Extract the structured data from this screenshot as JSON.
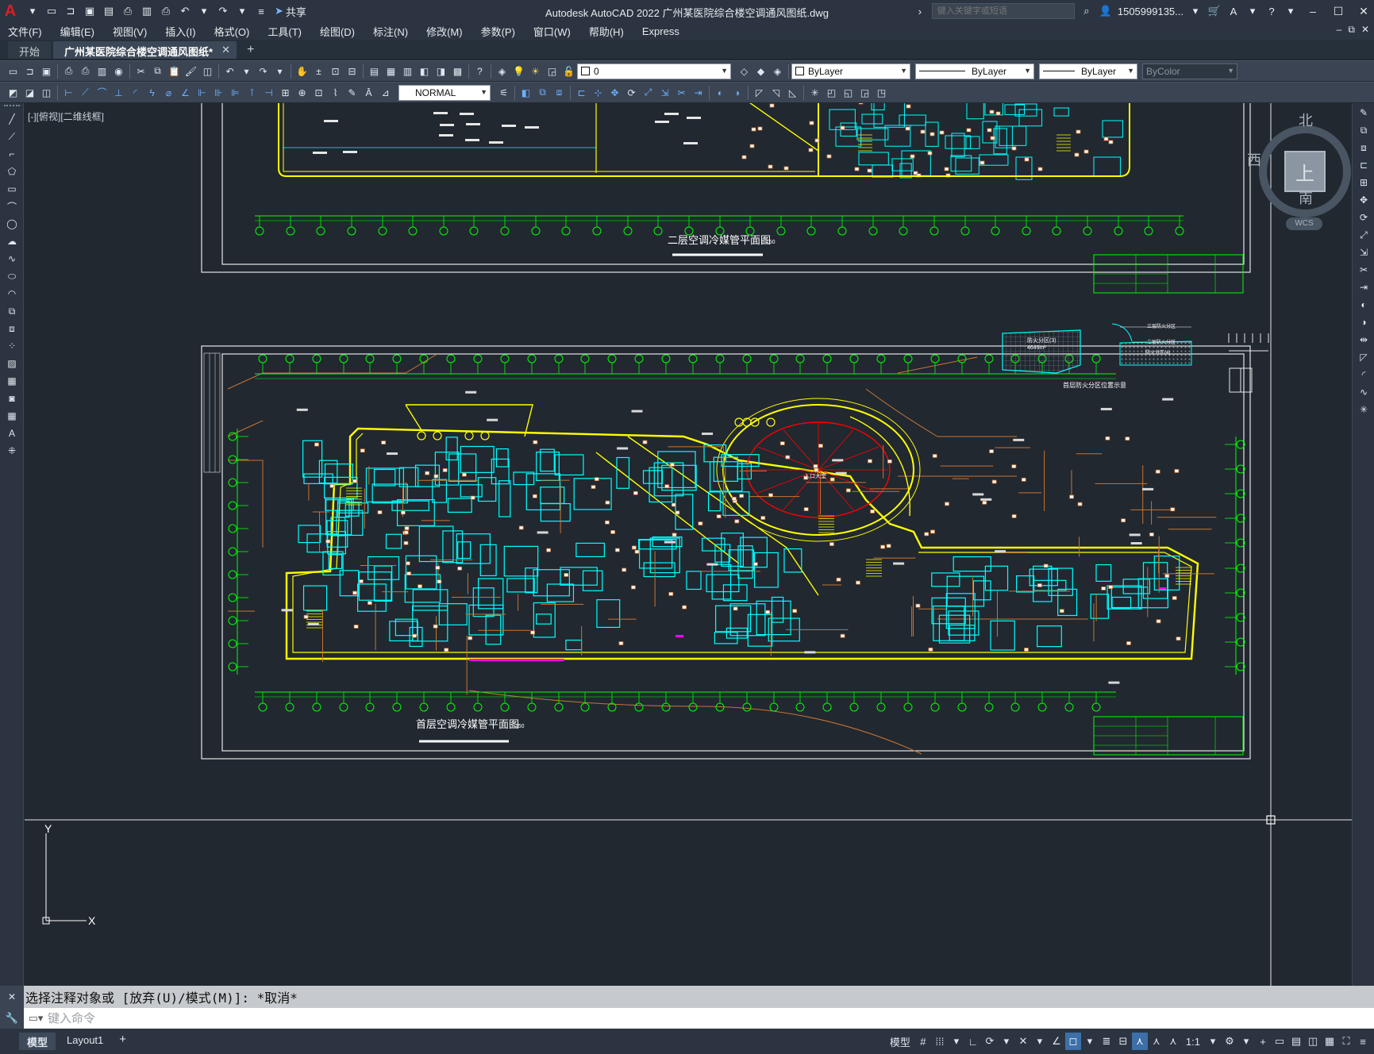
{
  "titlebar": {
    "app_logo": "A",
    "share_label": "共享",
    "title": "Autodesk AutoCAD 2022    广州某医院综合楼空调通风图纸.dwg",
    "search_placeholder": "键入关键字或短语",
    "user": "1505999135...",
    "icons": [
      "new-icon",
      "open-icon",
      "save-icon",
      "saveas-icon",
      "plot-icon",
      "undo-icon",
      "redo-icon",
      "share-icon",
      "search-icon",
      "user-icon",
      "cart-icon",
      "autodesk-app-icon",
      "help-icon",
      "minimize-icon",
      "maximize-icon",
      "close-icon"
    ]
  },
  "menubar": {
    "items": [
      "文件(F)",
      "编辑(E)",
      "视图(V)",
      "插入(I)",
      "格式(O)",
      "工具(T)",
      "绘图(D)",
      "标注(N)",
      "修改(M)",
      "参数(P)",
      "窗口(W)",
      "帮助(H)",
      "Express"
    ]
  },
  "tabs": {
    "items": [
      {
        "label": "开始",
        "active": false
      },
      {
        "label": "广州某医院综合楼空调通风图纸*",
        "active": true
      }
    ]
  },
  "toolbar1": {
    "layer_value": "0",
    "color_value": "ByLayer",
    "linetype_value": "ByLayer",
    "lineweight_value": "ByLayer",
    "plotstyle_value": "ByColor"
  },
  "toolbar2": {
    "dimstyle_value": "NORMAL"
  },
  "viewport": {
    "label": "[-][俯视][二维线框]"
  },
  "drawing": {
    "upper_title": "二层空调冷媒管平面图",
    "upper_scale": "1:150",
    "lower_title": "首层空调冷媒管平面图",
    "lower_scale": "1:150",
    "key_plan_caption": "首层防火分区位置示意",
    "zone_3_label": "防火分区(3)",
    "zone_3_area": "4649m²",
    "zone_4_label": "防火分区(4)",
    "zone_legend_1": "三层防火分区",
    "zone_legend_2": "二层防火分区",
    "entrance_label": "入口大堂",
    "ucs_x": "X",
    "ucs_y": "Y"
  },
  "viewcube": {
    "top": "上",
    "north": "北",
    "south": "南",
    "east": "东",
    "west": "西",
    "wcs": "WCS"
  },
  "command": {
    "history": "选择注释对象或 [放弃(U)/模式(M)]: *取消*",
    "placeholder": "键入命令"
  },
  "statusbar": {
    "layouts": [
      "模型",
      "Layout1"
    ],
    "model_label": "模型",
    "scale_label": "1:1"
  },
  "colors": {
    "canvas": "#212830",
    "frame": "#ffffff",
    "grid_axis": "#00ff00",
    "walls_yellow": "#ffff00",
    "walls_cyan": "#00ffff",
    "pipes_orange": "#c87533",
    "red": "#ff0000",
    "magenta": "#ff00ff"
  }
}
